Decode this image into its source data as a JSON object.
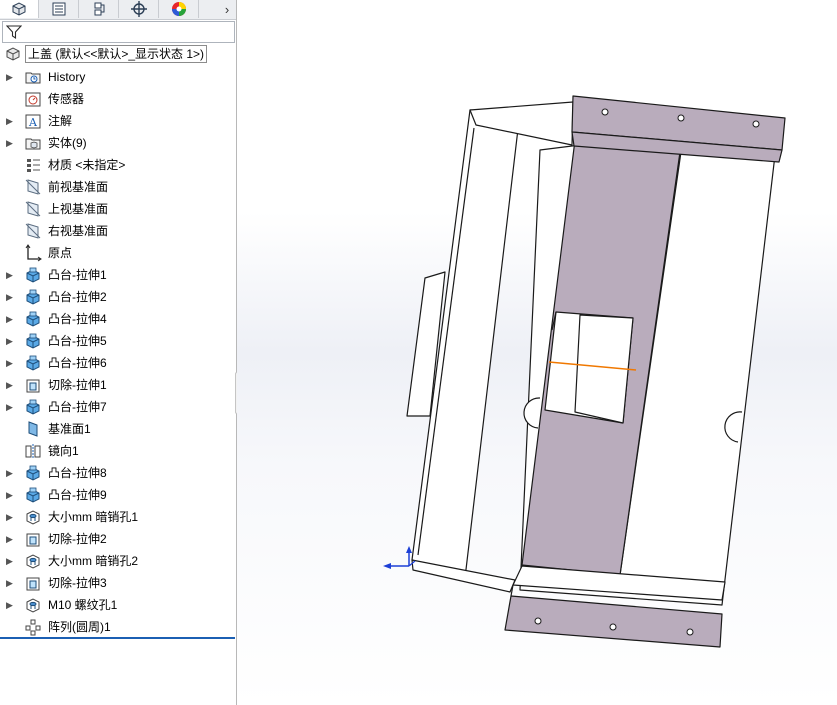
{
  "tabs": [
    {
      "name": "featuremanager-tab",
      "icon": "featuremanager-icon",
      "active": true
    },
    {
      "name": "propertymanager-tab",
      "icon": "propertymanager-icon",
      "active": false
    },
    {
      "name": "configurationmanager-tab",
      "icon": "configurationmanager-icon",
      "active": false
    },
    {
      "name": "dimxpertmanager-tab",
      "icon": "dimxpert-icon",
      "active": false
    },
    {
      "name": "displaymanager-tab",
      "icon": "displaymanager-icon",
      "active": false
    }
  ],
  "more_tabs_glyph": "›",
  "root": {
    "label": "上盖 (默认<<默认>_显示状态 1>)",
    "icon": "part-icon"
  },
  "tree": [
    {
      "label": "History",
      "icon": "history-folder-icon",
      "expandable": true
    },
    {
      "label": "传感器",
      "icon": "sensors-icon",
      "expandable": false
    },
    {
      "label": "注解",
      "icon": "annotations-icon",
      "expandable": true
    },
    {
      "label": "实体(9)",
      "icon": "solid-bodies-icon",
      "expandable": true
    },
    {
      "label": "材质 <未指定>",
      "icon": "material-icon",
      "expandable": false
    },
    {
      "label": "前视基准面",
      "icon": "plane-icon",
      "expandable": false
    },
    {
      "label": "上视基准面",
      "icon": "plane-icon",
      "expandable": false
    },
    {
      "label": "右视基准面",
      "icon": "plane-icon",
      "expandable": false
    },
    {
      "label": "原点",
      "icon": "origin-icon",
      "expandable": false
    },
    {
      "label": "凸台-拉伸1",
      "icon": "boss-extrude-icon",
      "expandable": true
    },
    {
      "label": "凸台-拉伸2",
      "icon": "boss-extrude-icon",
      "expandable": true
    },
    {
      "label": "凸台-拉伸4",
      "icon": "boss-extrude-icon",
      "expandable": true
    },
    {
      "label": "凸台-拉伸5",
      "icon": "boss-extrude-icon",
      "expandable": true
    },
    {
      "label": "凸台-拉伸6",
      "icon": "boss-extrude-icon",
      "expandable": true
    },
    {
      "label": "切除-拉伸1",
      "icon": "cut-extrude-icon",
      "expandable": true
    },
    {
      "label": "凸台-拉伸7",
      "icon": "boss-extrude-icon",
      "expandable": true
    },
    {
      "label": "基准面1",
      "icon": "plane1-icon",
      "expandable": false
    },
    {
      "label": "镜向1",
      "icon": "mirror-icon",
      "expandable": false
    },
    {
      "label": "凸台-拉伸8",
      "icon": "boss-extrude-icon",
      "expandable": true
    },
    {
      "label": "凸台-拉伸9",
      "icon": "boss-extrude-icon",
      "expandable": true
    },
    {
      "label": "大小mm 暗销孔1",
      "icon": "hole-wizard-icon",
      "expandable": true
    },
    {
      "label": "切除-拉伸2",
      "icon": "cut-extrude-icon",
      "expandable": true
    },
    {
      "label": "大小mm 暗销孔2",
      "icon": "hole-wizard-icon",
      "expandable": true
    },
    {
      "label": "切除-拉伸3",
      "icon": "cut-extrude-icon",
      "expandable": true
    },
    {
      "label": "M10 螺纹孔1",
      "icon": "hole-wizard-icon",
      "expandable": true
    },
    {
      "label": "阵列(圆周)1",
      "icon": "circular-pattern-icon",
      "expandable": false
    }
  ],
  "expander_glyph": "▶",
  "colors": {
    "accent": "#1b5fb3",
    "part_face": "#b9acbc",
    "panel_bg": "#ffffff",
    "tab_bg": "#eceef1",
    "sketch_orange": "#f07800",
    "triad_blue": "#1c3fd6"
  }
}
